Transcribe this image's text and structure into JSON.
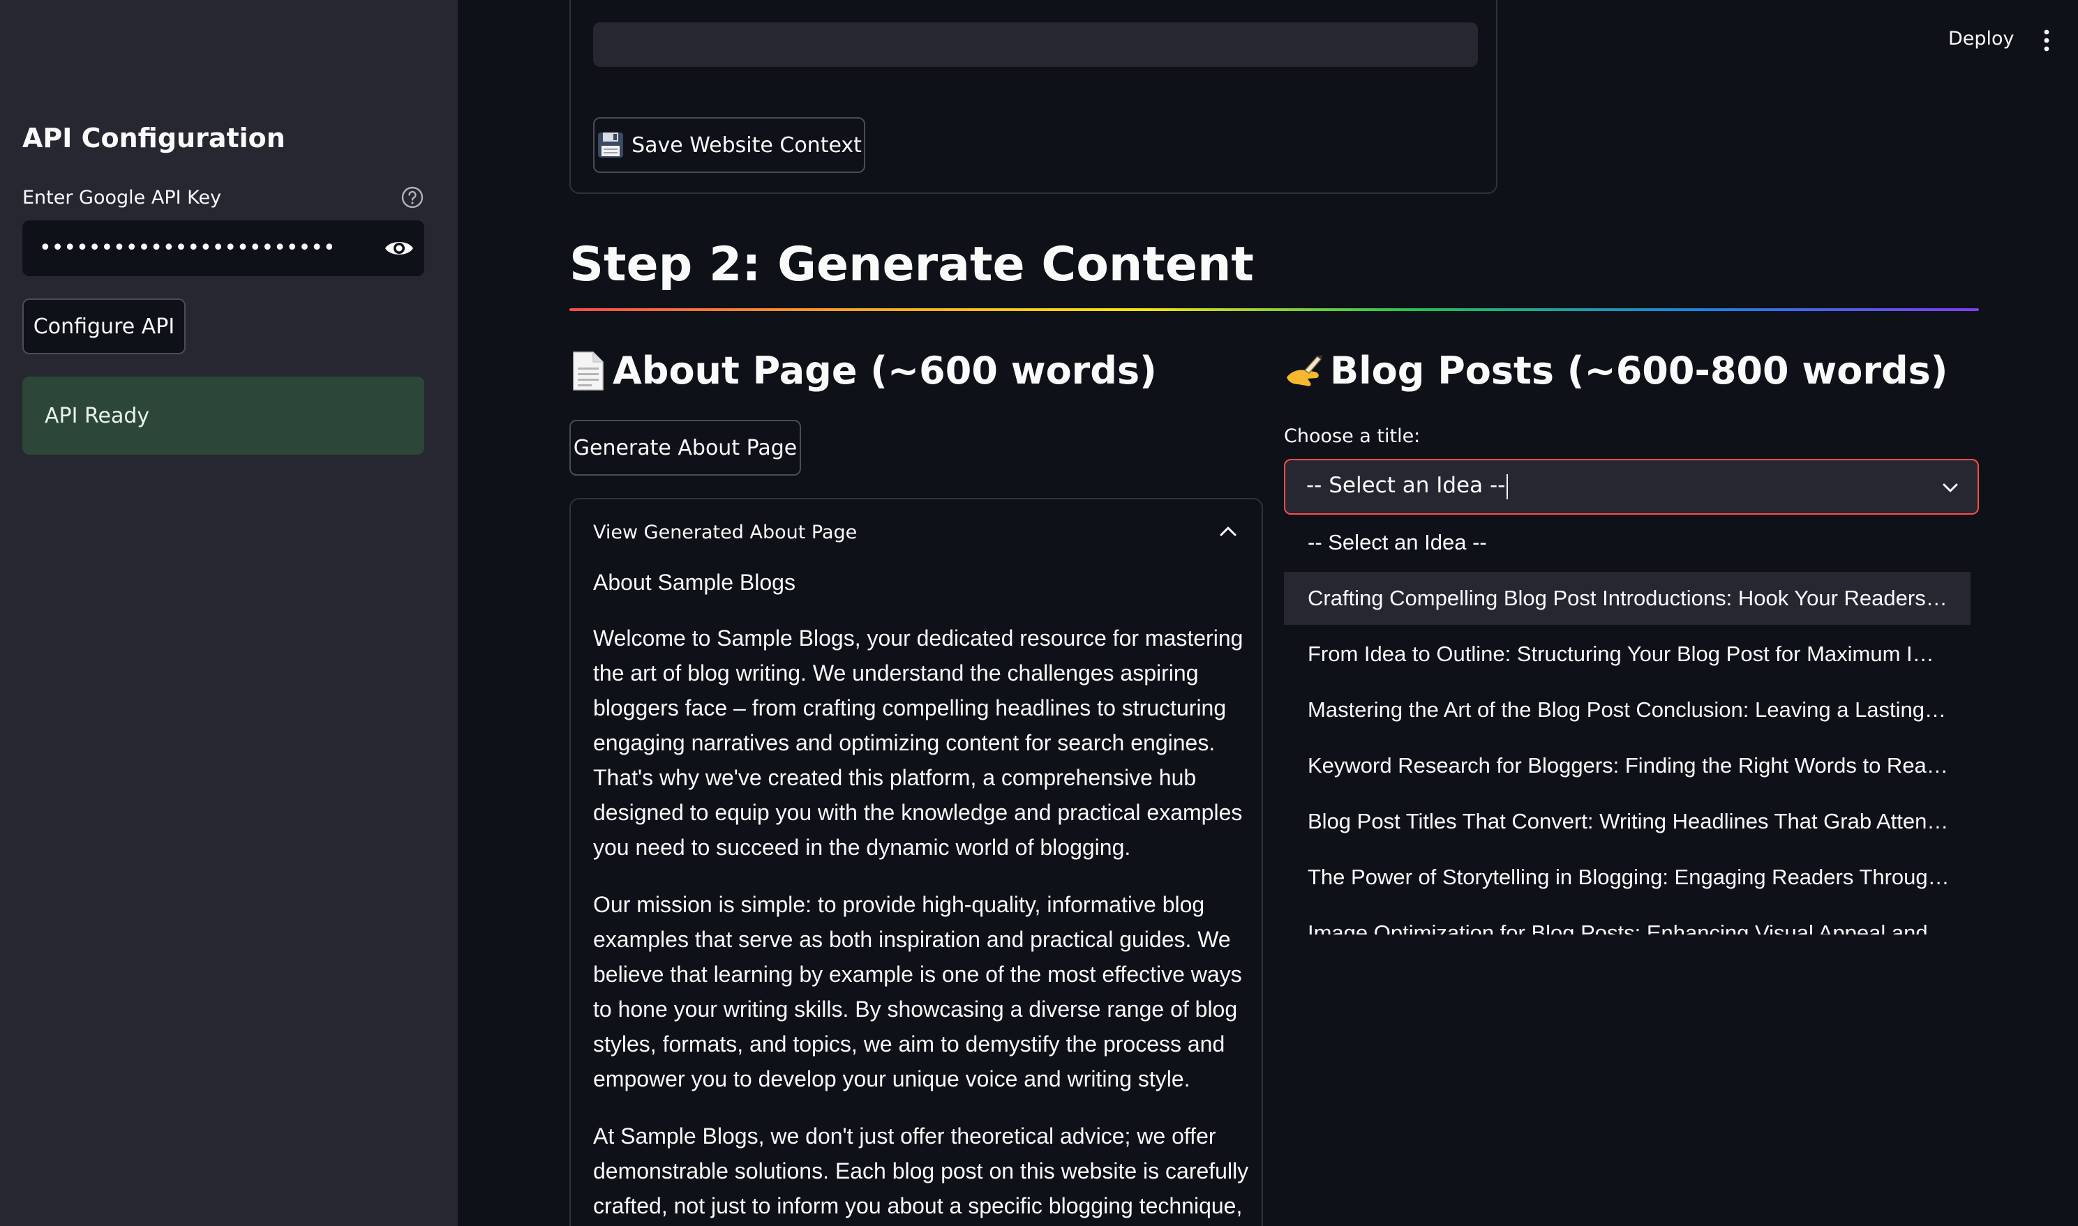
{
  "sidebar": {
    "title": "API Configuration",
    "key_label": "Enter Google API Key",
    "key_value": "••••••••••••••••••••••••••••••••••••••••",
    "configure_button": "Configure API",
    "status": "API Ready"
  },
  "header": {
    "deploy": "Deploy"
  },
  "step1": {
    "save_button": "Save Website Context"
  },
  "step2": {
    "title": "Step 2: Generate Content"
  },
  "about": {
    "heading": "About Page (~600 words)",
    "generate_button": "Generate About Page",
    "expander_label": "View Generated About Page",
    "subtitle": "About Sample Blogs",
    "paragraphs": [
      "Welcome to Sample Blogs, your dedicated resource for mastering the art of blog writing. We understand the challenges aspiring bloggers face – from crafting compelling headlines to structuring engaging narratives and optimizing content for search engines. That's why we've created this platform, a comprehensive hub designed to equip you with the knowledge and practical examples you need to succeed in the dynamic world of blogging.",
      "Our mission is simple: to provide high-quality, informative blog examples that serve as both inspiration and practical guides. We believe that learning by example is one of the most effective ways to hone your writing skills. By showcasing a diverse range of blog styles, formats, and topics, we aim to demystify the process and empower you to develop your unique voice and writing style.",
      "At Sample Blogs, we don't just offer theoretical advice; we offer demonstrable solutions. Each blog post on this website is carefully crafted, not just to inform you about a specific blogging technique,"
    ]
  },
  "blog": {
    "heading": "Blog Posts (~600-800 words)",
    "choose_label": "Choose a title:",
    "selected": "-- Select an Idea --",
    "options": [
      "-- Select an Idea --",
      "Crafting Compelling Blog Post Introductions: Hook Your Readers from the Start",
      "From Idea to Outline: Structuring Your Blog Post for Maximum Impact",
      "Mastering the Art of the Blog Post Conclusion: Leaving a Lasting Impression",
      "Keyword Research for Bloggers: Finding the Right Words to Reach Your Audience",
      "Blog Post Titles That Convert: Writing Headlines That Grab Attention",
      "The Power of Storytelling in Blogging: Engaging Readers Through Narrative",
      "Image Optimization for Blog Posts: Enhancing Visual Appeal and SEO"
    ],
    "highlighted_index": 1
  },
  "colors": {
    "background": "#0e1117",
    "sidebar": "#262730",
    "success": "#2c4737",
    "focus_border": "#ff4b4b"
  }
}
